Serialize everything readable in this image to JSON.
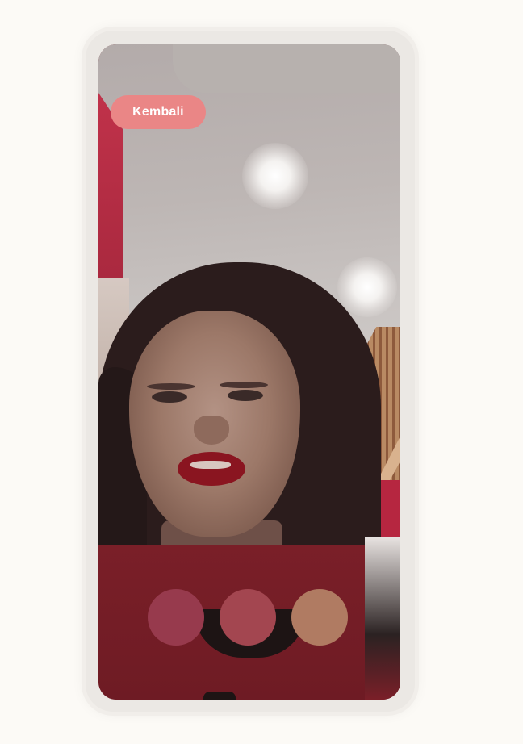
{
  "header": {
    "back_label": "Kembali"
  },
  "lip_colors": {
    "swatches": [
      {
        "name": "swatch-plum",
        "color": "#973a4d"
      },
      {
        "name": "swatch-rose",
        "color": "#a34650"
      },
      {
        "name": "swatch-nude",
        "color": "#b07b62"
      }
    ]
  },
  "theme": {
    "accent": "#ea8686",
    "page_background": "#fcfaf6"
  }
}
